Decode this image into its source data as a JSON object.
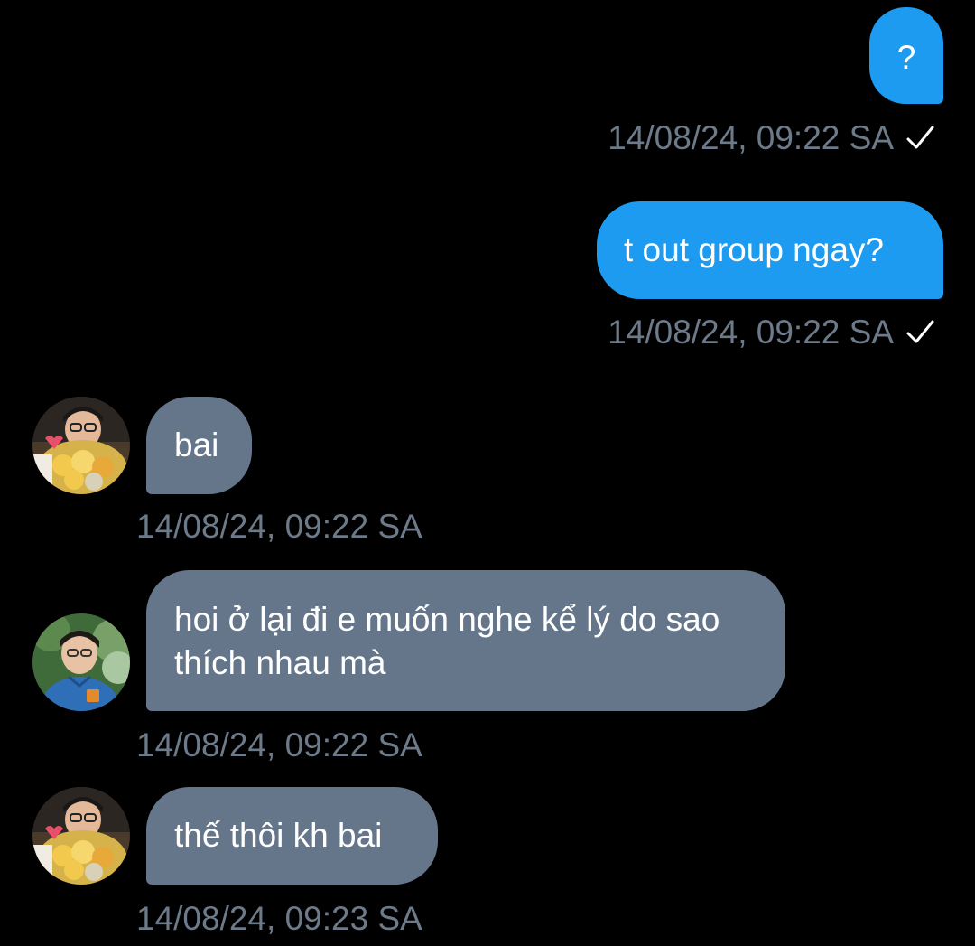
{
  "messages": [
    {
      "direction": "sent",
      "text": "?",
      "timestamp": "14/08/24, 09:22 SA",
      "status_icon": "check-icon"
    },
    {
      "direction": "sent",
      "text": "t out group ngay?",
      "timestamp": "14/08/24, 09:22 SA",
      "status_icon": "check-icon"
    },
    {
      "direction": "received",
      "text": "bai",
      "timestamp": "14/08/24, 09:22 SA",
      "avatar": "avatar-user-bouquet"
    },
    {
      "direction": "received",
      "text": "hoi ở lại đi e muốn nghe kể lý do sao thích nhau mà",
      "timestamp": "14/08/24, 09:22 SA",
      "avatar": "avatar-user-blue-shirt"
    },
    {
      "direction": "received",
      "text": "thế thôi kh bai",
      "timestamp": "14/08/24, 09:23 SA",
      "avatar": "avatar-user-bouquet"
    }
  ],
  "colors": {
    "background": "#000000",
    "sent_bubble": "#1d9bf0",
    "received_bubble": "#66768a",
    "timestamp": "#6c7a89",
    "text": "#ffffff"
  }
}
